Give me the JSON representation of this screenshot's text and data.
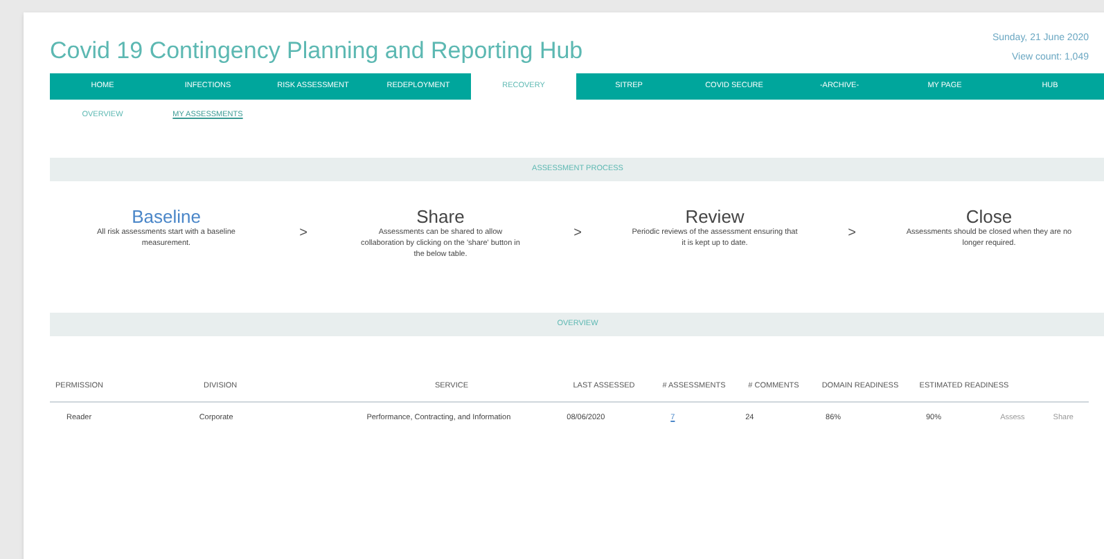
{
  "header": {
    "title": "Covid 19 Contingency Planning and Reporting Hub",
    "date": "Sunday, 21 June 2020",
    "view_count": "View count: 1,049"
  },
  "nav": [
    {
      "label": "HOME",
      "selected": false
    },
    {
      "label": "INFECTIONS",
      "selected": false
    },
    {
      "label": "RISK ASSESSMENT",
      "selected": false
    },
    {
      "label": "REDEPLOYMENT",
      "selected": false
    },
    {
      "label": "RECOVERY",
      "selected": true
    },
    {
      "label": "SITREP",
      "selected": false
    },
    {
      "label": "COVID SECURE",
      "selected": false
    },
    {
      "label": "-ARCHIVE-",
      "selected": false
    },
    {
      "label": "MY PAGE",
      "selected": false
    },
    {
      "label": "HUB",
      "selected": false
    }
  ],
  "subnav": [
    {
      "label": "OVERVIEW",
      "selected": false
    },
    {
      "label": "MY ASSESSMENTS",
      "selected": true
    }
  ],
  "process": {
    "heading": "ASSESSMENT PROCESS",
    "separator": ">",
    "steps": [
      {
        "title": "Baseline",
        "text": "All risk assessments start with a baseline measurement.",
        "selected": true
      },
      {
        "title": "Share",
        "text": "Assessments can be shared to allow collaboration by clicking on the 'share' button in the below table.",
        "selected": false
      },
      {
        "title": "Review",
        "text": "Periodic reviews of the assessment ensuring that it is kept up to date.",
        "selected": false
      },
      {
        "title": "Close",
        "text": "Assessments should be closed when they are no longer required.",
        "selected": false
      }
    ]
  },
  "overview": {
    "heading": "OVERVIEW"
  },
  "table": {
    "columns": [
      "PERMISSION",
      "DIVISION",
      "SERVICE",
      "LAST ASSESSED",
      "# ASSESSMENTS",
      "# COMMENTS",
      "DOMAIN READINESS",
      "ESTIMATED READINESS"
    ],
    "rows": [
      {
        "cells": [
          "Reader",
          "Corporate",
          "Performance, Contracting, and Information",
          "08/06/2020",
          "7",
          "24",
          "86%",
          "90%"
        ],
        "actions": [
          "Assess",
          "Share"
        ]
      }
    ]
  }
}
